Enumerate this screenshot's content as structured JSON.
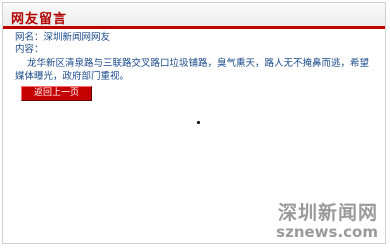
{
  "header": {
    "title": "网友留言"
  },
  "message": {
    "name_label": "网名：",
    "name_value": "深圳新闻网网友",
    "content_label": "内容：",
    "content_text": "龙华新区清泉路与三联路交叉路口垃圾铺路，臭气熏天，路人无不掩鼻而逃，希望媒体曝光，政府部门重视。"
  },
  "actions": {
    "back_label": "返回上一页"
  },
  "watermark": {
    "cn": "深圳新闻网",
    "en": "sznews.com"
  }
}
